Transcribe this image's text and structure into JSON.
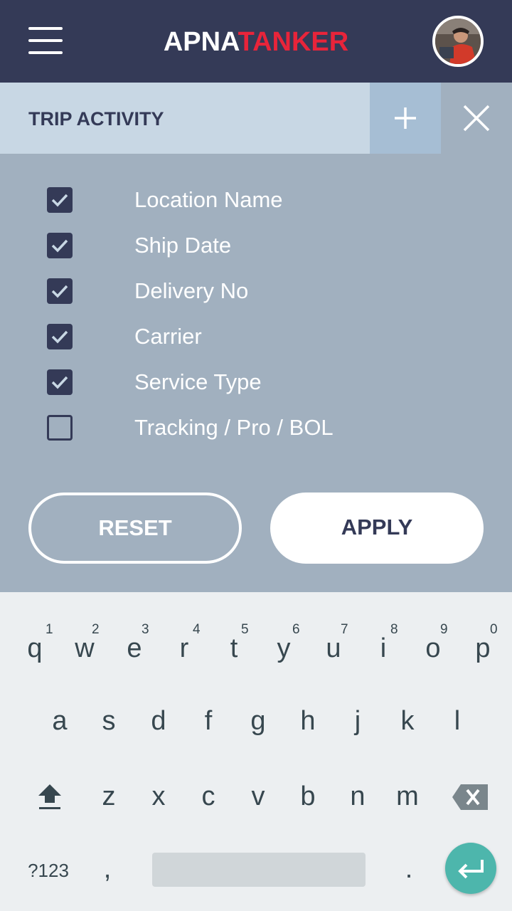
{
  "header": {
    "logo_part1": "APNA",
    "logo_part2": "TANKER",
    "logo_color_primary": "#ffffff",
    "logo_color_accent": "#e8243a",
    "background": "#343a57"
  },
  "filter_panel": {
    "title": "TRIP ACTIVITY",
    "options": [
      {
        "label": "Location Name",
        "checked": true
      },
      {
        "label": "Ship Date",
        "checked": true
      },
      {
        "label": "Delivery No",
        "checked": true
      },
      {
        "label": "Carrier",
        "checked": true
      },
      {
        "label": "Service Type",
        "checked": true
      },
      {
        "label": "Tracking / Pro / BOL",
        "checked": false
      }
    ],
    "reset_label": "RESET",
    "apply_label": "APPLY"
  },
  "keyboard": {
    "row1": [
      {
        "key": "q",
        "hint": "1"
      },
      {
        "key": "w",
        "hint": "2"
      },
      {
        "key": "e",
        "hint": "3"
      },
      {
        "key": "r",
        "hint": "4"
      },
      {
        "key": "t",
        "hint": "5"
      },
      {
        "key": "y",
        "hint": "6"
      },
      {
        "key": "u",
        "hint": "7"
      },
      {
        "key": "i",
        "hint": "8"
      },
      {
        "key": "o",
        "hint": "9"
      },
      {
        "key": "p",
        "hint": "0"
      }
    ],
    "row2": [
      "a",
      "s",
      "d",
      "f",
      "g",
      "h",
      "j",
      "k",
      "l"
    ],
    "row3": [
      "z",
      "x",
      "c",
      "v",
      "b",
      "n",
      "m"
    ],
    "symbols_label": "?123",
    "comma": ",",
    "period": ".",
    "accent_color": "#4db6ac"
  }
}
